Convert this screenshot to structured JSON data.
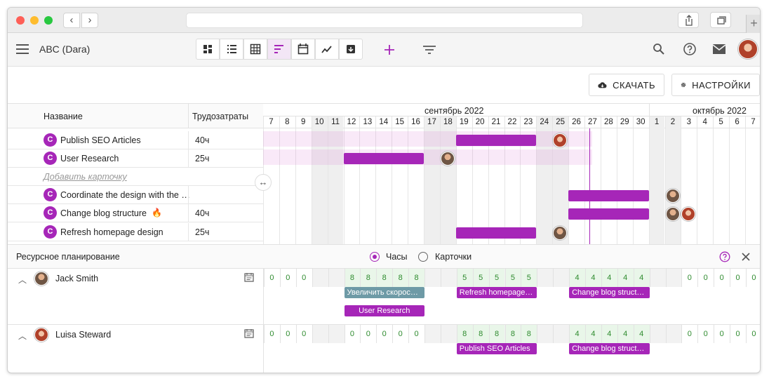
{
  "app": {
    "title": "ABC (Dara)",
    "add_icon": "plus-icon",
    "filter_icon": "filter-icon",
    "accent": "#a626b8"
  },
  "toolbar": {
    "download_label": "СКАЧАТЬ",
    "settings_label": "НАСТРОЙКИ"
  },
  "table": {
    "col_name": "Название",
    "col_effort": "Трудозатраты",
    "add_card": "Добавить карточку",
    "rows": [
      {
        "badge": "C",
        "name": "Publish SEO Articles",
        "effort": "40ч"
      },
      {
        "badge": "C",
        "name": "User Research",
        "effort": "25ч"
      },
      {
        "badge": "C",
        "name": "Coordinate the design with the …",
        "effort": ""
      },
      {
        "badge": "C",
        "name": "Change blog structure",
        "effort": "40ч"
      },
      {
        "badge": "C",
        "name": "Refresh homepage design",
        "effort": "25ч"
      }
    ]
  },
  "timeline": {
    "month1": "сентябрь 2022",
    "month2": "октябрь 2022",
    "days": [
      "7",
      "8",
      "9",
      "10",
      "11",
      "12",
      "13",
      "14",
      "15",
      "16",
      "17",
      "18",
      "19",
      "20",
      "21",
      "22",
      "23",
      "24",
      "25",
      "26",
      "27",
      "28",
      "29",
      "30",
      "1",
      "2",
      "3",
      "4",
      "5",
      "6",
      "7"
    ]
  },
  "resource": {
    "title": "Ресурсное планирование",
    "opt_hours": "Часы",
    "opt_cards": "Карточки",
    "people": [
      {
        "name": "Jack Smith",
        "hours": [
          "0",
          "0",
          "0",
          "",
          "",
          "8",
          "8",
          "8",
          "8",
          "8",
          "",
          "",
          "5",
          "5",
          "5",
          "5",
          "5",
          "",
          "",
          "4",
          "4",
          "4",
          "4",
          "4",
          "",
          "",
          "0",
          "0",
          "0",
          "0",
          "0"
        ],
        "chips": [
          {
            "label": "Увеличить скорос…",
            "color": "#6e9aa6"
          },
          {
            "label": "Refresh homepage …",
            "color": "#a626b8"
          },
          {
            "label": "Change blog struct…",
            "color": "#a626b8"
          },
          {
            "label": "User Research",
            "color": "#a626b8"
          }
        ]
      },
      {
        "name": "Luisa Steward",
        "hours": [
          "0",
          "0",
          "0",
          "",
          "",
          "0",
          "0",
          "0",
          "0",
          "0",
          "",
          "",
          "8",
          "8",
          "8",
          "8",
          "8",
          "",
          "",
          "4",
          "4",
          "4",
          "4",
          "4",
          "",
          "",
          "0",
          "0",
          "0",
          "0",
          "0"
        ],
        "chips": [
          {
            "label": "Publish SEO Articles",
            "color": "#a626b8"
          },
          {
            "label": "Change blog struct…",
            "color": "#a626b8"
          }
        ]
      }
    ]
  }
}
